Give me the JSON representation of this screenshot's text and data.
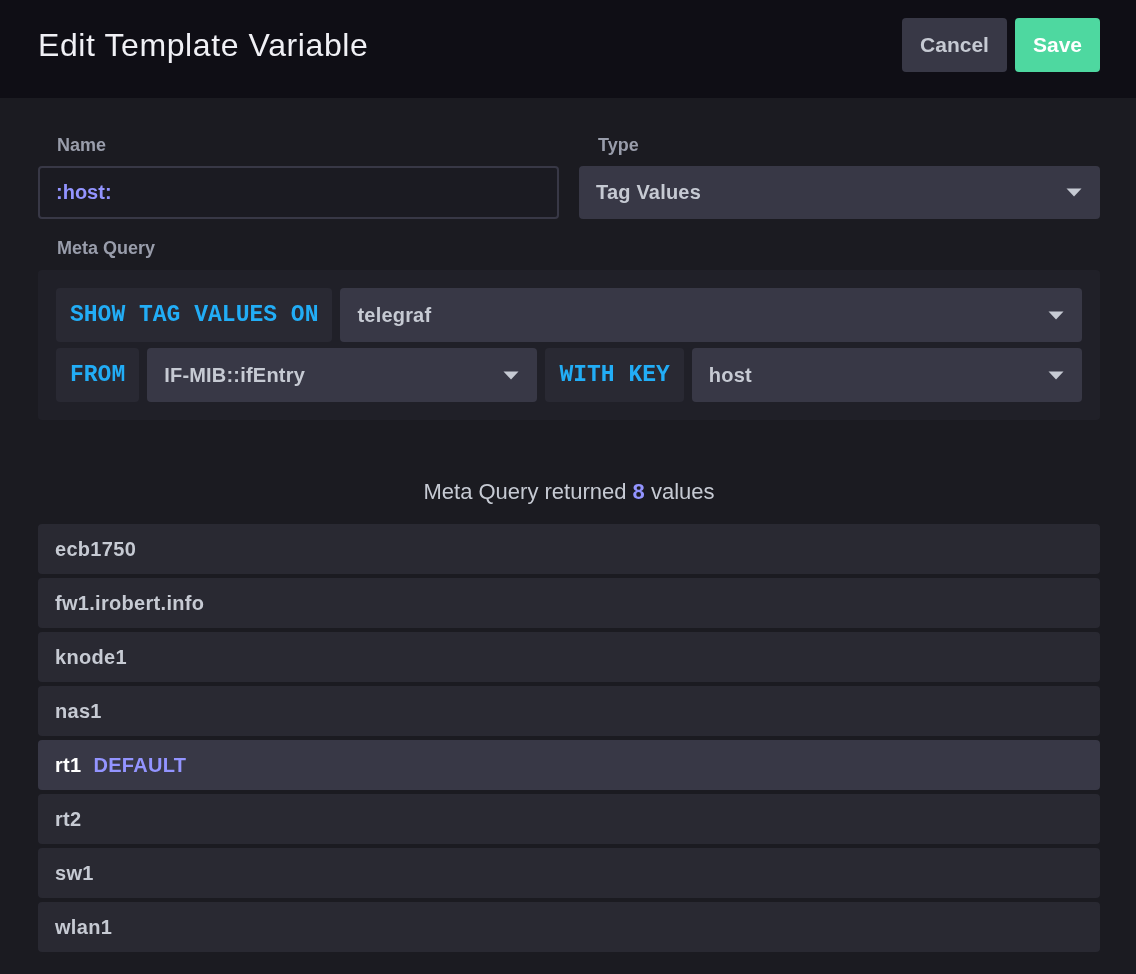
{
  "header": {
    "title": "Edit Template Variable",
    "buttons": [
      {
        "label": "Cancel",
        "kind": "secondary"
      },
      {
        "label": "Save",
        "kind": "primary"
      }
    ]
  },
  "fields": [
    {
      "label": "Name",
      "kind": "text",
      "value": ":host:"
    },
    {
      "label": "Type",
      "kind": "dropdown",
      "value": "Tag Values"
    }
  ],
  "meta_query": {
    "label": "Meta Query",
    "rows": [
      {
        "parts": [
          {
            "kind": "keyword",
            "text": "SHOW TAG VALUES ON"
          },
          {
            "kind": "dropdown",
            "value": "telegraf"
          }
        ]
      },
      {
        "parts": [
          {
            "kind": "keyword",
            "text": "FROM"
          },
          {
            "kind": "dropdown",
            "value": "IF-MIB::ifEntry"
          },
          {
            "kind": "keyword",
            "text": "WITH KEY"
          },
          {
            "kind": "dropdown",
            "value": "host"
          }
        ]
      }
    ]
  },
  "results": {
    "summary": "Meta Query returned **8** values",
    "values": [
      {
        "label": "ecb1750",
        "selected": false
      },
      {
        "label": "fw1.irobert.info",
        "selected": false
      },
      {
        "label": "knode1",
        "selected": false
      },
      {
        "label": "nas1",
        "selected": false
      },
      {
        "label": "rt1",
        "selected": true,
        "badge": "DEFAULT"
      },
      {
        "label": "rt2",
        "selected": false
      },
      {
        "label": "sw1",
        "selected": false
      },
      {
        "label": "wlan1",
        "selected": false
      }
    ]
  }
}
